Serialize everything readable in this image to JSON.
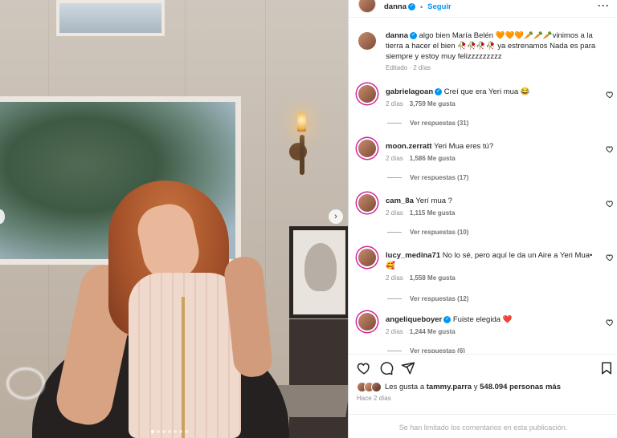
{
  "post": {
    "author": "danna",
    "follow_label": "Seguir",
    "caption_text": "algo bien María Belén 🧡🧡🧡🥕🥕🥕vinimos a la tierra a hacer el bien 🥀🥀🥀🥀 ya estrenamos Nada es para siempre y estoy muy felizzzzzzzzz",
    "edited_label": "Editado · 2 días",
    "carousel_count": 7,
    "carousel_active": 1
  },
  "comments": [
    {
      "user": "gabrielagoan",
      "verified": true,
      "text": "Creí que era Yeri mua 😂",
      "age": "2 días",
      "likes": "3,759 Me gusta",
      "replies": "Ver respuestas (31)"
    },
    {
      "user": "moon.zerratt",
      "verified": false,
      "text": "Yeri Mua eres tú?",
      "age": "2 días",
      "likes": "1,586 Me gusta",
      "replies": "Ver respuestas (17)"
    },
    {
      "user": "cam_8a",
      "verified": false,
      "text": "Yerí mua ?",
      "age": "2 días",
      "likes": "1,115 Me gusta",
      "replies": "Ver respuestas (10)"
    },
    {
      "user": "lucy_medina71",
      "verified": false,
      "text": "No lo sé, pero aquí le da un Aire a Yeri Mua• 🥰",
      "age": "2 días",
      "likes": "1,558 Me gusta",
      "replies": "Ver respuestas (12)"
    },
    {
      "user": "angeliqueboyer",
      "verified": true,
      "text": "Fuiste elegida ❤️",
      "age": "2 días",
      "likes": "1,244 Me gusta",
      "replies": "Ver respuestas (6)"
    }
  ],
  "likes_summary": {
    "prefix": "Les gusta a",
    "user": "tammy.parra",
    "conj": "y",
    "others": "548.094 personas más"
  },
  "posted_time": "Hace 2 días",
  "comments_limited": "Se han limitado los comentarios en esta publicación.",
  "colors": {
    "accent": "#0095f6",
    "heart": "#ed4956"
  }
}
